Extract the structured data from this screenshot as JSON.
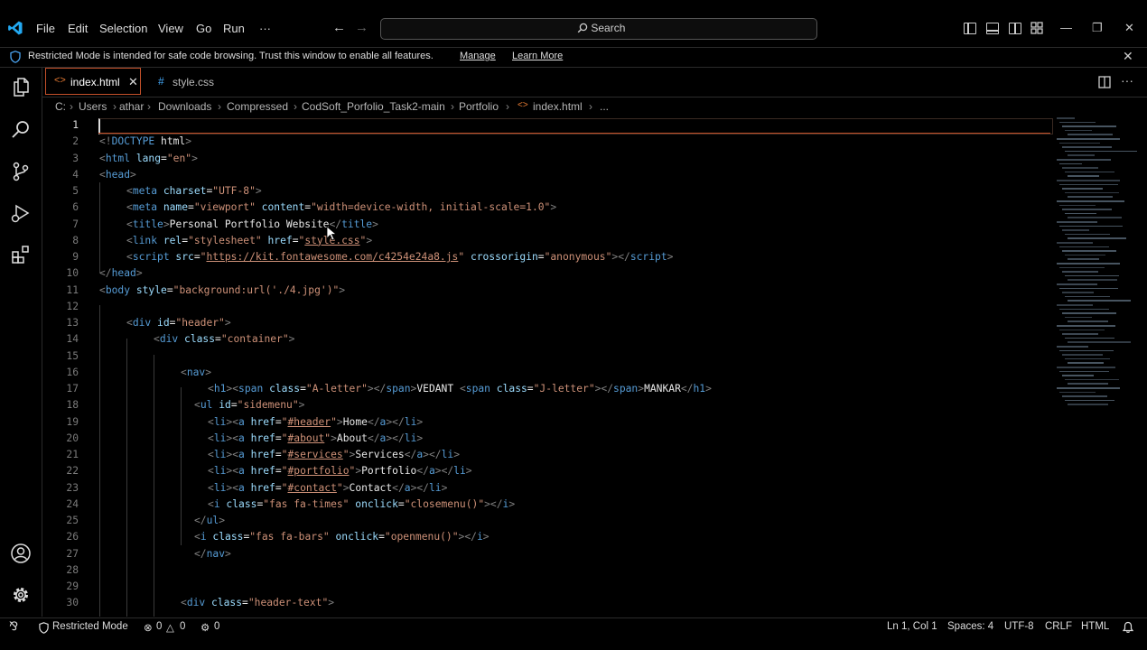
{
  "menubar": [
    "File",
    "Edit",
    "Selection",
    "View",
    "Go",
    "Run",
    "···"
  ],
  "search": {
    "label": "Search"
  },
  "banner": {
    "message": "Restricted Mode is intended for safe code browsing. Trust this window to enable all features.",
    "manage": "Manage",
    "learn_more": "Learn More"
  },
  "tabs": [
    {
      "label": "index.html",
      "active": true
    },
    {
      "label": "style.css",
      "active": false
    }
  ],
  "breadcrumb": [
    "C:",
    "Users",
    "athar",
    "Downloads",
    "Compressed",
    "CodSoft_Porfolio_Task2-main",
    "Portfolio",
    "index.html",
    "..."
  ],
  "code_lines": [
    {
      "n": "1",
      "indent": 0,
      "tokens": []
    },
    {
      "n": "2",
      "indent": 0,
      "tokens": [
        [
          "br",
          "<!"
        ],
        [
          "tag",
          "DOCTYPE"
        ],
        [
          "txt",
          " html"
        ],
        [
          "br",
          ">"
        ]
      ]
    },
    {
      "n": "3",
      "indent": 0,
      "tokens": [
        [
          "br",
          "<"
        ],
        [
          "tag",
          "html"
        ],
        [
          "attr",
          " lang"
        ],
        [
          "txt",
          "="
        ],
        [
          "str",
          "\"en\""
        ],
        [
          "br",
          ">"
        ]
      ]
    },
    {
      "n": "4",
      "indent": 0,
      "tokens": [
        [
          "br",
          "<"
        ],
        [
          "tag",
          "head"
        ],
        [
          "br",
          ">"
        ]
      ]
    },
    {
      "n": "5",
      "indent": 1,
      "tokens": [
        [
          "br",
          "<"
        ],
        [
          "tag",
          "meta"
        ],
        [
          "attr",
          " charset"
        ],
        [
          "txt",
          "="
        ],
        [
          "str",
          "\"UTF-8\""
        ],
        [
          "br",
          ">"
        ]
      ]
    },
    {
      "n": "6",
      "indent": 1,
      "tokens": [
        [
          "br",
          "<"
        ],
        [
          "tag",
          "meta"
        ],
        [
          "attr",
          " name"
        ],
        [
          "txt",
          "="
        ],
        [
          "str",
          "\"viewport\""
        ],
        [
          "attr",
          " content"
        ],
        [
          "txt",
          "="
        ],
        [
          "str",
          "\"width=device-width, initial-scale=1.0\""
        ],
        [
          "br",
          ">"
        ]
      ]
    },
    {
      "n": "7",
      "indent": 1,
      "tokens": [
        [
          "br",
          "<"
        ],
        [
          "tag",
          "title"
        ],
        [
          "br",
          ">"
        ],
        [
          "txt",
          "Personal Portfolio Website"
        ],
        [
          "br",
          "</"
        ],
        [
          "tag",
          "title"
        ],
        [
          "br",
          ">"
        ]
      ]
    },
    {
      "n": "8",
      "indent": 1,
      "tokens": [
        [
          "br",
          "<"
        ],
        [
          "tag",
          "link"
        ],
        [
          "attr",
          " rel"
        ],
        [
          "txt",
          "="
        ],
        [
          "str",
          "\"stylesheet\""
        ],
        [
          "attr",
          " href"
        ],
        [
          "txt",
          "="
        ],
        [
          "str",
          "\""
        ],
        [
          "url",
          "style.css"
        ],
        [
          "str",
          "\""
        ],
        [
          "br",
          ">"
        ]
      ]
    },
    {
      "n": "9",
      "indent": 1,
      "tokens": [
        [
          "br",
          "<"
        ],
        [
          "tag",
          "script"
        ],
        [
          "attr",
          " src"
        ],
        [
          "txt",
          "="
        ],
        [
          "str",
          "\""
        ],
        [
          "url",
          "https://kit.fontawesome.com/c4254e24a8.js"
        ],
        [
          "str",
          "\""
        ],
        [
          "attr",
          " crossorigin"
        ],
        [
          "txt",
          "="
        ],
        [
          "str",
          "\"anonymous\""
        ],
        [
          "br",
          "></"
        ],
        [
          "tag",
          "script"
        ],
        [
          "br",
          ">"
        ]
      ]
    },
    {
      "n": "10",
      "indent": 0,
      "tokens": [
        [
          "br",
          "</"
        ],
        [
          "tag",
          "head"
        ],
        [
          "br",
          ">"
        ]
      ]
    },
    {
      "n": "11",
      "indent": 0,
      "tokens": [
        [
          "br",
          "<"
        ],
        [
          "tag",
          "body"
        ],
        [
          "attr",
          " style"
        ],
        [
          "txt",
          "="
        ],
        [
          "str",
          "\"background:url('./4.jpg')\""
        ],
        [
          "br",
          ">"
        ]
      ]
    },
    {
      "n": "12",
      "indent": 0,
      "tokens": []
    },
    {
      "n": "13",
      "indent": 1,
      "tokens": [
        [
          "br",
          "<"
        ],
        [
          "tag",
          "div"
        ],
        [
          "attr",
          " id"
        ],
        [
          "txt",
          "="
        ],
        [
          "str",
          "\"header\""
        ],
        [
          "br",
          ">"
        ]
      ]
    },
    {
      "n": "14",
      "indent": 2,
      "tokens": [
        [
          "br",
          "<"
        ],
        [
          "tag",
          "div"
        ],
        [
          "attr",
          " class"
        ],
        [
          "txt",
          "="
        ],
        [
          "str",
          "\"container\""
        ],
        [
          "br",
          ">"
        ]
      ]
    },
    {
      "n": "15",
      "indent": 0,
      "tokens": []
    },
    {
      "n": "16",
      "indent": 3,
      "tokens": [
        [
          "br",
          "<"
        ],
        [
          "tag",
          "nav"
        ],
        [
          "br",
          ">"
        ]
      ]
    },
    {
      "n": "17",
      "indent": 4,
      "tokens": [
        [
          "br",
          "<"
        ],
        [
          "tag",
          "h1"
        ],
        [
          "br",
          ">"
        ],
        [
          "br",
          "<"
        ],
        [
          "tag",
          "span"
        ],
        [
          "attr",
          " class"
        ],
        [
          "txt",
          "="
        ],
        [
          "str",
          "\"A-letter\""
        ],
        [
          "br",
          "></"
        ],
        [
          "tag",
          "span"
        ],
        [
          "br",
          ">"
        ],
        [
          "txt",
          "VEDANT "
        ],
        [
          "br",
          "<"
        ],
        [
          "tag",
          "span"
        ],
        [
          "attr",
          " class"
        ],
        [
          "txt",
          "="
        ],
        [
          "str",
          "\"J-letter\""
        ],
        [
          "br",
          "></"
        ],
        [
          "tag",
          "span"
        ],
        [
          "br",
          ">"
        ],
        [
          "txt",
          "MANKAR"
        ],
        [
          "br",
          "</"
        ],
        [
          "tag",
          "h1"
        ],
        [
          "br",
          ">"
        ]
      ]
    },
    {
      "n": "18",
      "indent": 3.5,
      "tokens": [
        [
          "br",
          "<"
        ],
        [
          "tag",
          "ul"
        ],
        [
          "attr",
          " id"
        ],
        [
          "txt",
          "="
        ],
        [
          "str",
          "\"sidemenu\""
        ],
        [
          "br",
          ">"
        ]
      ]
    },
    {
      "n": "19",
      "indent": 4,
      "tokens": [
        [
          "br",
          "<"
        ],
        [
          "tag",
          "li"
        ],
        [
          "br",
          "><"
        ],
        [
          "tag",
          "a"
        ],
        [
          "attr",
          " href"
        ],
        [
          "txt",
          "="
        ],
        [
          "str",
          "\""
        ],
        [
          "url",
          "#header"
        ],
        [
          "str",
          "\""
        ],
        [
          "br",
          ">"
        ],
        [
          "txt",
          "Home"
        ],
        [
          "br",
          "</"
        ],
        [
          "tag",
          "a"
        ],
        [
          "br",
          "></"
        ],
        [
          "tag",
          "li"
        ],
        [
          "br",
          ">"
        ]
      ]
    },
    {
      "n": "20",
      "indent": 4,
      "tokens": [
        [
          "br",
          "<"
        ],
        [
          "tag",
          "li"
        ],
        [
          "br",
          "><"
        ],
        [
          "tag",
          "a"
        ],
        [
          "attr",
          " href"
        ],
        [
          "txt",
          "="
        ],
        [
          "str",
          "\""
        ],
        [
          "url",
          "#about"
        ],
        [
          "str",
          "\""
        ],
        [
          "br",
          ">"
        ],
        [
          "txt",
          "About"
        ],
        [
          "br",
          "</"
        ],
        [
          "tag",
          "a"
        ],
        [
          "br",
          "></"
        ],
        [
          "tag",
          "li"
        ],
        [
          "br",
          ">"
        ]
      ]
    },
    {
      "n": "21",
      "indent": 4,
      "tokens": [
        [
          "br",
          "<"
        ],
        [
          "tag",
          "li"
        ],
        [
          "br",
          "><"
        ],
        [
          "tag",
          "a"
        ],
        [
          "attr",
          " href"
        ],
        [
          "txt",
          "="
        ],
        [
          "str",
          "\""
        ],
        [
          "url",
          "#services"
        ],
        [
          "str",
          "\""
        ],
        [
          "br",
          ">"
        ],
        [
          "txt",
          "Services"
        ],
        [
          "br",
          "</"
        ],
        [
          "tag",
          "a"
        ],
        [
          "br",
          "></"
        ],
        [
          "tag",
          "li"
        ],
        [
          "br",
          ">"
        ]
      ]
    },
    {
      "n": "22",
      "indent": 4,
      "tokens": [
        [
          "br",
          "<"
        ],
        [
          "tag",
          "li"
        ],
        [
          "br",
          "><"
        ],
        [
          "tag",
          "a"
        ],
        [
          "attr",
          " href"
        ],
        [
          "txt",
          "="
        ],
        [
          "str",
          "\""
        ],
        [
          "url",
          "#portfolio"
        ],
        [
          "str",
          "\""
        ],
        [
          "br",
          ">"
        ],
        [
          "txt",
          "Portfolio"
        ],
        [
          "br",
          "</"
        ],
        [
          "tag",
          "a"
        ],
        [
          "br",
          "></"
        ],
        [
          "tag",
          "li"
        ],
        [
          "br",
          ">"
        ]
      ]
    },
    {
      "n": "23",
      "indent": 4,
      "tokens": [
        [
          "br",
          "<"
        ],
        [
          "tag",
          "li"
        ],
        [
          "br",
          "><"
        ],
        [
          "tag",
          "a"
        ],
        [
          "attr",
          " href"
        ],
        [
          "txt",
          "="
        ],
        [
          "str",
          "\""
        ],
        [
          "url",
          "#contact"
        ],
        [
          "str",
          "\""
        ],
        [
          "br",
          ">"
        ],
        [
          "txt",
          "Contact"
        ],
        [
          "br",
          "</"
        ],
        [
          "tag",
          "a"
        ],
        [
          "br",
          "></"
        ],
        [
          "tag",
          "li"
        ],
        [
          "br",
          ">"
        ]
      ]
    },
    {
      "n": "24",
      "indent": 4,
      "tokens": [
        [
          "br",
          "<"
        ],
        [
          "tag",
          "i"
        ],
        [
          "attr",
          " class"
        ],
        [
          "txt",
          "="
        ],
        [
          "str",
          "\"fas fa-times\""
        ],
        [
          "attr",
          " onclick"
        ],
        [
          "txt",
          "="
        ],
        [
          "str",
          "\"closemenu()\""
        ],
        [
          "br",
          "></"
        ],
        [
          "tag",
          "i"
        ],
        [
          "br",
          ">"
        ]
      ]
    },
    {
      "n": "25",
      "indent": 3.5,
      "tokens": [
        [
          "br",
          "</"
        ],
        [
          "tag",
          "ul"
        ],
        [
          "br",
          ">"
        ]
      ]
    },
    {
      "n": "26",
      "indent": 3.5,
      "tokens": [
        [
          "br",
          "<"
        ],
        [
          "tag",
          "i"
        ],
        [
          "attr",
          " class"
        ],
        [
          "txt",
          "="
        ],
        [
          "str",
          "\"fas fa-bars\""
        ],
        [
          "attr",
          " onclick"
        ],
        [
          "txt",
          "="
        ],
        [
          "str",
          "\"openmenu()\""
        ],
        [
          "br",
          "></"
        ],
        [
          "tag",
          "i"
        ],
        [
          "br",
          ">"
        ]
      ]
    },
    {
      "n": "27",
      "indent": 3.5,
      "tokens": [
        [
          "br",
          "</"
        ],
        [
          "tag",
          "nav"
        ],
        [
          "br",
          ">"
        ]
      ]
    },
    {
      "n": "28",
      "indent": 0,
      "tokens": []
    },
    {
      "n": "29",
      "indent": 0,
      "tokens": []
    },
    {
      "n": "30",
      "indent": 3,
      "tokens": [
        [
          "br",
          "<"
        ],
        [
          "tag",
          "div"
        ],
        [
          "attr",
          " class"
        ],
        [
          "txt",
          "="
        ],
        [
          "str",
          "\"header-text\""
        ],
        [
          "br",
          ">"
        ]
      ]
    }
  ],
  "statusbar": {
    "mode": "Restricted Mode",
    "errors": "0",
    "warnings": "0",
    "ports": "0",
    "position": "Ln 1, Col 1",
    "spaces": "Spaces: 4",
    "encoding": "UTF-8",
    "eol": "CRLF",
    "language": "HTML"
  },
  "colors": {
    "tag": "#569cd6",
    "attr": "#9cdcfe",
    "string": "#ce9178",
    "text": "#e8e8e8",
    "bracket": "#808080",
    "logo": "#23a9f2",
    "html_icon": "#e37933",
    "css_icon": "#42a5f5"
  }
}
